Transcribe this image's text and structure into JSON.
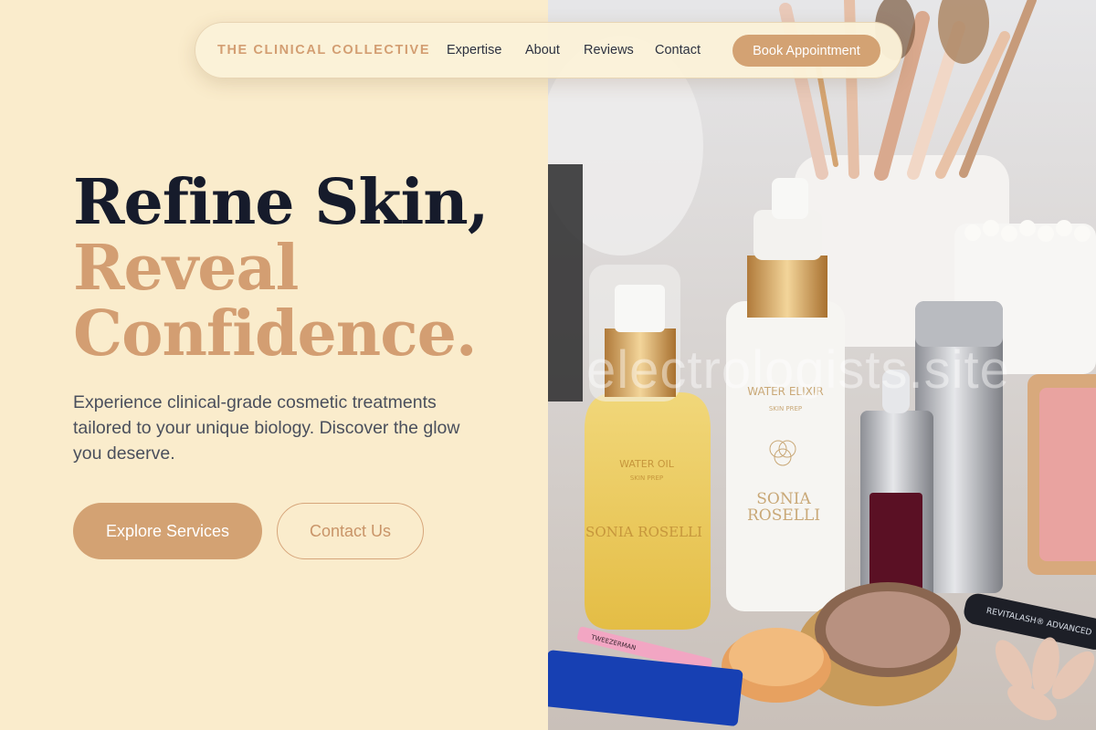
{
  "nav": {
    "brand": "THE CLINICAL COLLECTIVE",
    "links": [
      "Expertise",
      "About",
      "Reviews",
      "Contact"
    ],
    "cta": "Book Appointment"
  },
  "hero": {
    "headline_line1": "Refine Skin,",
    "headline_line2": "Reveal",
    "headline_line3": "Confidence.",
    "subcopy": "Experience clinical-grade cosmetic treatments tailored to your unique biology. Discover the glow you deserve.",
    "primary_button": "Explore Services",
    "secondary_button": "Contact Us"
  },
  "photo": {
    "watermark": "electrologists.site",
    "product_labels": {
      "oil_bottle_top": "WATER OIL",
      "oil_bottle_sub": "SKIN PREP",
      "oil_bottle_brand": "SONIA ROSELLI",
      "elixir_top": "WATER ELIXIR",
      "elixir_sub": "SKIN PREP",
      "elixir_brand_1": "SONIA",
      "elixir_brand_2": "ROSELLI",
      "tweezer": "TWEEZERMAN",
      "lash": "REVITALASH® ADVANCED"
    }
  },
  "colors": {
    "background": "#faeccc",
    "accent": "#d3a273",
    "heading": "#161b2b",
    "body_text": "#4a4f5c"
  }
}
